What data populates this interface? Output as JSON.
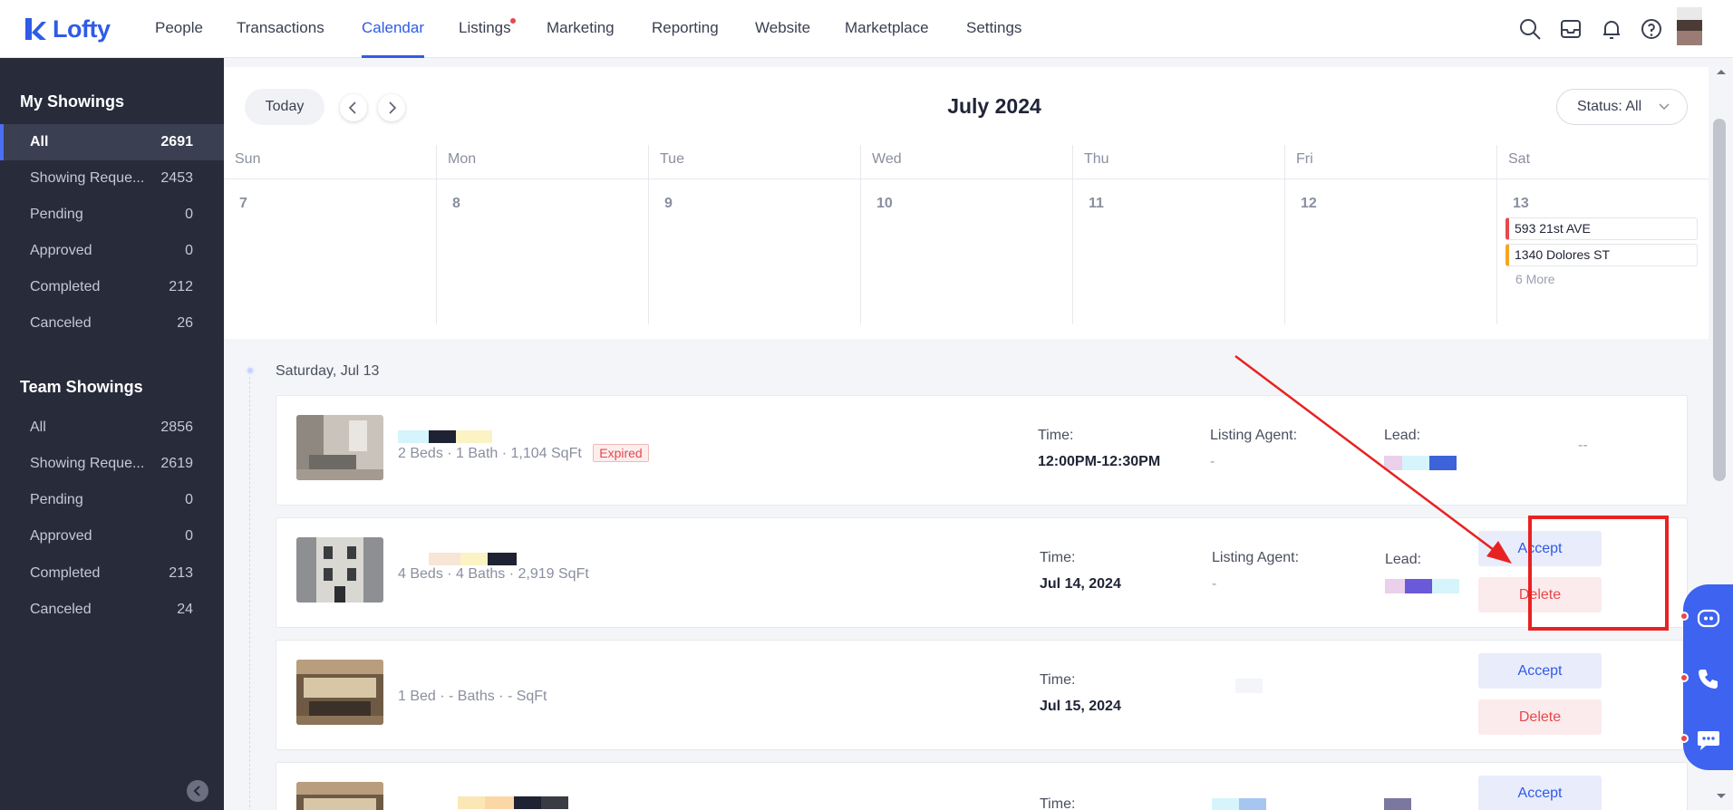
{
  "nav": {
    "logo": "Lofty",
    "items": [
      {
        "label": "People"
      },
      {
        "label": "Transactions"
      },
      {
        "label": "Calendar"
      },
      {
        "label": "Listings"
      },
      {
        "label": "Marketing"
      },
      {
        "label": "Reporting"
      },
      {
        "label": "Website"
      },
      {
        "label": "Marketplace"
      },
      {
        "label": "Settings"
      }
    ],
    "active": "Calendar"
  },
  "sidebar": {
    "my_title": "My Showings",
    "my_items": [
      {
        "label": "All",
        "count": "2691"
      },
      {
        "label": "Showing Reque...",
        "count": "2453"
      },
      {
        "label": "Pending",
        "count": "0"
      },
      {
        "label": "Approved",
        "count": "0"
      },
      {
        "label": "Completed",
        "count": "212"
      },
      {
        "label": "Canceled",
        "count": "26"
      }
    ],
    "team_title": "Team Showings",
    "team_items": [
      {
        "label": "All",
        "count": "2856"
      },
      {
        "label": "Showing Reque...",
        "count": "2619"
      },
      {
        "label": "Pending",
        "count": "0"
      },
      {
        "label": "Approved",
        "count": "0"
      },
      {
        "label": "Completed",
        "count": "213"
      },
      {
        "label": "Canceled",
        "count": "24"
      }
    ]
  },
  "calendar": {
    "today_label": "Today",
    "month_title": "July 2024",
    "status_filter": "Status: All",
    "weekdays": [
      "Sun",
      "Mon",
      "Tue",
      "Wed",
      "Thu",
      "Fri",
      "Sat"
    ],
    "days": [
      "7",
      "8",
      "9",
      "10",
      "11",
      "12",
      "13"
    ],
    "sat_events": [
      {
        "label": "593 21st AVE",
        "color": "#e5484d"
      },
      {
        "label": "1340 Dolores ST",
        "color": "#f5a623"
      }
    ],
    "more_label": "6 More"
  },
  "list": {
    "date_label": "Saturday, Jul 13",
    "time_label": "Time:",
    "agent_label": "Listing Agent:",
    "lead_label": "Lead:",
    "accept_label": "Accept",
    "delete_label": "Delete",
    "cards": [
      {
        "details": "2 Beds · 1 Bath · 1,104 SqFt",
        "badge": "Expired",
        "time": "12:00PM-12:30PM",
        "agent": "-",
        "lead_status": "--"
      },
      {
        "details": "4 Beds · 4 Baths · 2,919 SqFt",
        "time": "Jul 14, 2024",
        "agent": "-"
      },
      {
        "details": "1 Bed · - Baths · - SqFt",
        "time": "Jul 15, 2024"
      },
      {
        "time_label_only": "Time:"
      }
    ]
  }
}
